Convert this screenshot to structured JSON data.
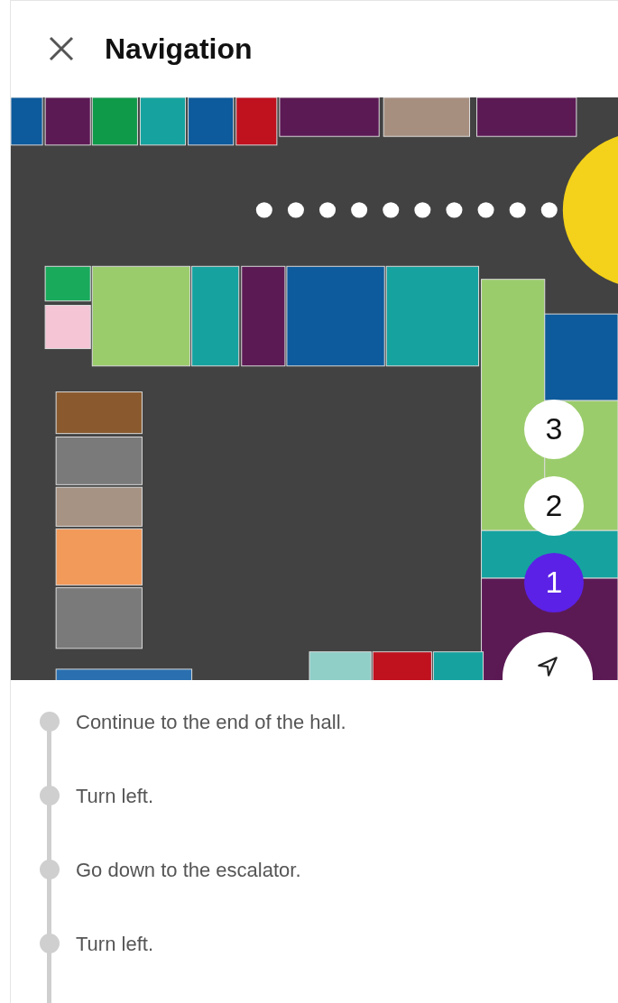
{
  "header": {
    "title": "Navigation"
  },
  "map": {
    "pins": [
      {
        "label": "3",
        "selected": false
      },
      {
        "label": "2",
        "selected": false
      },
      {
        "label": "1",
        "selected": true
      }
    ]
  },
  "steps": [
    {
      "text": "Continue to the end of the hall."
    },
    {
      "text": "Turn left."
    },
    {
      "text": "Go down to the escalator."
    },
    {
      "text": "Turn left."
    }
  ]
}
